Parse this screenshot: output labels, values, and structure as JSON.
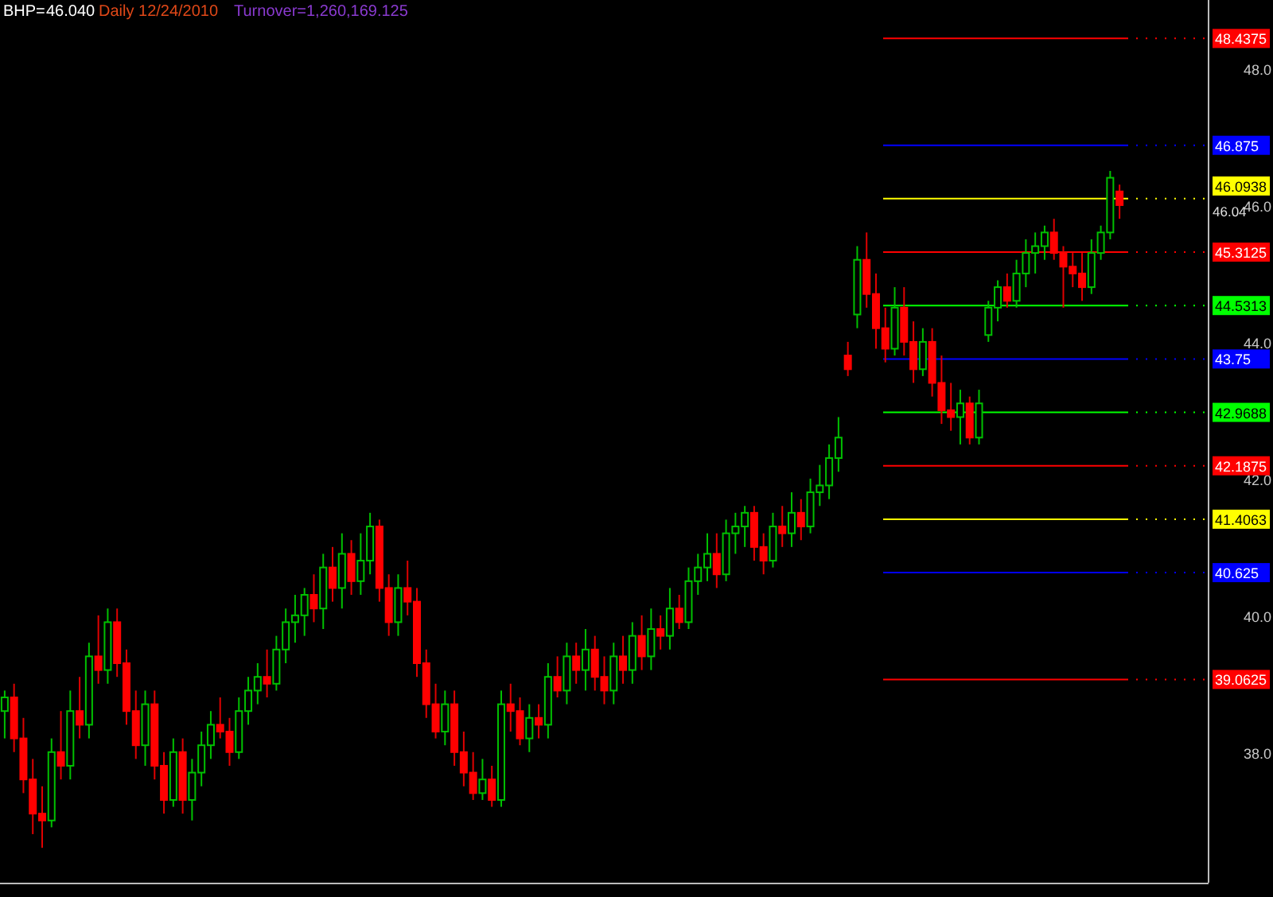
{
  "header": {
    "symbol": "BHP=",
    "last": "46.040",
    "period": "Daily 12/24/2010",
    "turnover": "Turnover=1,260,169.125"
  },
  "chart": {
    "last_price_label": "46.04",
    "chart_data": {
      "type": "candlestick",
      "ylim": [
        36.09,
        49.0
      ],
      "yticks": [
        {
          "value": 38,
          "label": "38.0"
        },
        {
          "value": 40,
          "label": "40.0"
        },
        {
          "value": 42,
          "label": "42.0"
        },
        {
          "value": 44,
          "label": "44.0"
        },
        {
          "value": 46,
          "label": "46.0"
        },
        {
          "value": 48,
          "label": "48.0"
        }
      ],
      "categories": [
        null,
        null,
        null,
        null,
        null,
        null,
        null,
        null,
        null,
        null,
        null,
        null,
        null,
        null,
        null,
        null,
        null,
        null,
        null,
        null,
        null,
        null,
        null,
        null,
        null,
        null,
        null,
        null,
        null,
        null,
        null,
        null,
        null,
        null,
        null,
        null,
        null,
        null,
        null,
        null,
        null,
        null,
        null,
        null,
        null,
        null,
        null,
        null,
        null,
        null,
        null,
        null,
        null,
        null,
        null,
        null,
        null,
        null,
        null,
        null,
        null,
        null,
        null,
        null,
        null,
        null,
        null,
        null,
        null,
        null,
        null,
        null,
        null,
        null,
        null,
        null,
        null,
        null,
        null,
        null,
        null,
        null,
        null,
        null,
        null,
        null,
        null,
        null,
        null,
        null,
        null,
        null,
        null,
        null,
        null,
        null,
        null,
        null,
        null,
        null,
        null,
        null,
        null,
        null,
        null,
        null,
        null,
        null,
        null,
        null,
        null,
        null,
        null,
        null,
        null,
        null,
        null,
        null,
        null,
        null,
        null,
        null,
        null,
        null,
        null,
        null,
        null,
        null,
        null
      ],
      "ohlc": [
        [
          38.6,
          38.9,
          38.2,
          38.8
        ],
        [
          38.8,
          39.0,
          38.0,
          38.2
        ],
        [
          38.2,
          38.5,
          37.4,
          37.6
        ],
        [
          37.6,
          37.9,
          36.8,
          37.1
        ],
        [
          37.1,
          37.5,
          36.6,
          37.0
        ],
        [
          37.0,
          38.2,
          36.9,
          38.0
        ],
        [
          38.0,
          38.6,
          37.6,
          37.8
        ],
        [
          37.8,
          38.9,
          37.6,
          38.6
        ],
        [
          38.6,
          39.1,
          38.2,
          38.4
        ],
        [
          38.4,
          39.6,
          38.2,
          39.4
        ],
        [
          39.4,
          40.0,
          39.0,
          39.2
        ],
        [
          39.2,
          40.1,
          39.0,
          39.9
        ],
        [
          39.9,
          40.1,
          39.1,
          39.3
        ],
        [
          39.3,
          39.5,
          38.4,
          38.6
        ],
        [
          38.6,
          38.9,
          37.9,
          38.1
        ],
        [
          38.1,
          38.9,
          37.8,
          38.7
        ],
        [
          38.7,
          38.9,
          37.6,
          37.8
        ],
        [
          37.8,
          38.0,
          37.1,
          37.3
        ],
        [
          37.3,
          38.2,
          37.2,
          38.0
        ],
        [
          38.0,
          38.2,
          37.1,
          37.3
        ],
        [
          37.3,
          37.9,
          37.0,
          37.7
        ],
        [
          37.7,
          38.3,
          37.5,
          38.1
        ],
        [
          38.1,
          38.6,
          37.9,
          38.4
        ],
        [
          38.4,
          38.8,
          38.2,
          38.3
        ],
        [
          38.3,
          38.5,
          37.8,
          38.0
        ],
        [
          38.0,
          38.8,
          37.9,
          38.6
        ],
        [
          38.6,
          39.1,
          38.4,
          38.9
        ],
        [
          38.9,
          39.3,
          38.7,
          39.1
        ],
        [
          39.1,
          39.5,
          38.8,
          39.0
        ],
        [
          39.0,
          39.7,
          38.9,
          39.5
        ],
        [
          39.5,
          40.1,
          39.3,
          39.9
        ],
        [
          39.9,
          40.3,
          39.6,
          40.0
        ],
        [
          40.0,
          40.4,
          39.7,
          40.3
        ],
        [
          40.3,
          40.6,
          39.9,
          40.1
        ],
        [
          40.1,
          40.9,
          39.8,
          40.7
        ],
        [
          40.7,
          41.0,
          40.2,
          40.4
        ],
        [
          40.4,
          41.2,
          40.1,
          40.9
        ],
        [
          40.9,
          41.1,
          40.3,
          40.5
        ],
        [
          40.5,
          41.2,
          40.3,
          40.8
        ],
        [
          40.8,
          41.5,
          40.6,
          41.3
        ],
        [
          41.3,
          41.4,
          40.2,
          40.4
        ],
        [
          40.4,
          40.6,
          39.7,
          39.9
        ],
        [
          39.9,
          40.6,
          39.7,
          40.4
        ],
        [
          40.4,
          40.8,
          40.0,
          40.2
        ],
        [
          40.2,
          40.4,
          39.1,
          39.3
        ],
        [
          39.3,
          39.5,
          38.5,
          38.7
        ],
        [
          38.7,
          39.0,
          38.2,
          38.3
        ],
        [
          38.3,
          38.9,
          38.1,
          38.7
        ],
        [
          38.7,
          38.9,
          37.8,
          38.0
        ],
        [
          38.0,
          38.3,
          37.5,
          37.7
        ],
        [
          37.7,
          38.0,
          37.3,
          37.4
        ],
        [
          37.4,
          37.9,
          37.3,
          37.6
        ],
        [
          37.6,
          37.8,
          37.2,
          37.3
        ],
        [
          37.3,
          38.9,
          37.2,
          38.7
        ],
        [
          38.7,
          39.0,
          38.3,
          38.6
        ],
        [
          38.6,
          38.8,
          38.1,
          38.2
        ],
        [
          38.2,
          38.7,
          38.0,
          38.5
        ],
        [
          38.5,
          38.7,
          38.2,
          38.4
        ],
        [
          38.4,
          39.3,
          38.2,
          39.1
        ],
        [
          39.1,
          39.4,
          38.8,
          38.9
        ],
        [
          38.9,
          39.6,
          38.7,
          39.4
        ],
        [
          39.4,
          39.6,
          39.0,
          39.2
        ],
        [
          39.2,
          39.8,
          38.9,
          39.5
        ],
        [
          39.5,
          39.7,
          38.9,
          39.1
        ],
        [
          39.1,
          39.4,
          38.7,
          38.9
        ],
        [
          38.9,
          39.6,
          38.7,
          39.4
        ],
        [
          39.4,
          39.7,
          39.0,
          39.2
        ],
        [
          39.2,
          39.9,
          39.0,
          39.7
        ],
        [
          39.7,
          40.0,
          39.2,
          39.4
        ],
        [
          39.4,
          40.1,
          39.2,
          39.8
        ],
        [
          39.8,
          40.0,
          39.5,
          39.7
        ],
        [
          39.7,
          40.4,
          39.5,
          40.1
        ],
        [
          40.1,
          40.3,
          39.8,
          39.9
        ],
        [
          39.9,
          40.7,
          39.8,
          40.5
        ],
        [
          40.5,
          40.9,
          40.3,
          40.7
        ],
        [
          40.7,
          41.2,
          40.5,
          40.9
        ],
        [
          40.9,
          41.2,
          40.4,
          40.6
        ],
        [
          40.6,
          41.4,
          40.5,
          41.2
        ],
        [
          41.2,
          41.5,
          40.9,
          41.3
        ],
        [
          41.3,
          41.6,
          41.0,
          41.5
        ],
        [
          41.5,
          41.6,
          40.8,
          41.0
        ],
        [
          41.0,
          41.2,
          40.6,
          40.8
        ],
        [
          40.8,
          41.5,
          40.7,
          41.3
        ],
        [
          41.3,
          41.6,
          41.0,
          41.2
        ],
        [
          41.2,
          41.8,
          41.0,
          41.5
        ],
        [
          41.5,
          41.7,
          41.1,
          41.3
        ],
        [
          41.3,
          42.0,
          41.2,
          41.8
        ],
        [
          41.8,
          42.2,
          41.6,
          41.9
        ],
        [
          41.9,
          42.5,
          41.7,
          42.3
        ],
        [
          42.3,
          42.9,
          42.1,
          42.6
        ],
        [
          43.8,
          44.0,
          43.5,
          43.6
        ],
        [
          44.4,
          45.4,
          44.2,
          45.2
        ],
        [
          45.2,
          45.6,
          44.5,
          44.7
        ],
        [
          44.7,
          45.0,
          43.9,
          44.2
        ],
        [
          44.2,
          44.5,
          43.7,
          43.9
        ],
        [
          43.9,
          44.8,
          43.8,
          44.5
        ],
        [
          44.5,
          44.8,
          43.8,
          44.0
        ],
        [
          44.0,
          44.3,
          43.4,
          43.6
        ],
        [
          43.6,
          44.2,
          43.5,
          44.0
        ],
        [
          44.0,
          44.2,
          43.2,
          43.4
        ],
        [
          43.4,
          43.8,
          42.8,
          43.0
        ],
        [
          43.0,
          43.4,
          42.7,
          42.9
        ],
        [
          42.9,
          43.3,
          42.5,
          43.1
        ],
        [
          43.1,
          43.2,
          42.5,
          42.6
        ],
        [
          42.6,
          43.3,
          42.5,
          43.1
        ],
        [
          44.1,
          44.6,
          44.0,
          44.5
        ],
        [
          44.5,
          44.9,
          44.3,
          44.8
        ],
        [
          44.8,
          45.0,
          44.5,
          44.6
        ],
        [
          44.6,
          45.2,
          44.5,
          45.0
        ],
        [
          45.0,
          45.5,
          44.8,
          45.3
        ],
        [
          45.3,
          45.6,
          45.0,
          45.4
        ],
        [
          45.4,
          45.7,
          45.2,
          45.6
        ],
        [
          45.6,
          45.8,
          45.2,
          45.3
        ],
        [
          45.3,
          45.4,
          44.5,
          45.1
        ],
        [
          45.1,
          45.3,
          44.8,
          45.0
        ],
        [
          45.0,
          45.3,
          44.6,
          44.8
        ],
        [
          44.8,
          45.5,
          44.7,
          45.3
        ],
        [
          45.3,
          45.7,
          45.2,
          45.6
        ],
        [
          45.6,
          46.5,
          45.5,
          46.4
        ],
        [
          46.2,
          46.3,
          45.8,
          46.0
        ],
        null,
        null,
        null,
        null,
        null,
        null,
        null,
        null,
        null
      ],
      "ref_lines": [
        {
          "axis": "y",
          "value": 48.4375,
          "label": "48.4375",
          "color": "#ff0000"
        },
        {
          "axis": "y",
          "value": 46.875,
          "label": "46.875",
          "color": "#0000ff"
        },
        {
          "axis": "y",
          "value": 46.0938,
          "label": "46.0938",
          "color": "#ffff00"
        },
        {
          "axis": "y",
          "value": 45.3125,
          "label": "45.3125",
          "color": "#ff0000"
        },
        {
          "axis": "y",
          "value": 44.5313,
          "label": "44.5313",
          "color": "#00ff00"
        },
        {
          "axis": "y",
          "value": 43.75,
          "label": "43.75",
          "color": "#0000ff"
        },
        {
          "axis": "y",
          "value": 42.9688,
          "label": "42.9688",
          "color": "#00ff00"
        },
        {
          "axis": "y",
          "value": 42.1875,
          "label": "42.1875",
          "color": "#ff0000"
        },
        {
          "axis": "y",
          "value": 41.4063,
          "label": "41.4063",
          "color": "#ffff00"
        },
        {
          "axis": "y",
          "value": 40.625,
          "label": "40.625",
          "color": "#0000ff"
        },
        {
          "axis": "y",
          "value": 39.0625,
          "label": "39.0625",
          "color": "#ff0000"
        }
      ]
    }
  }
}
